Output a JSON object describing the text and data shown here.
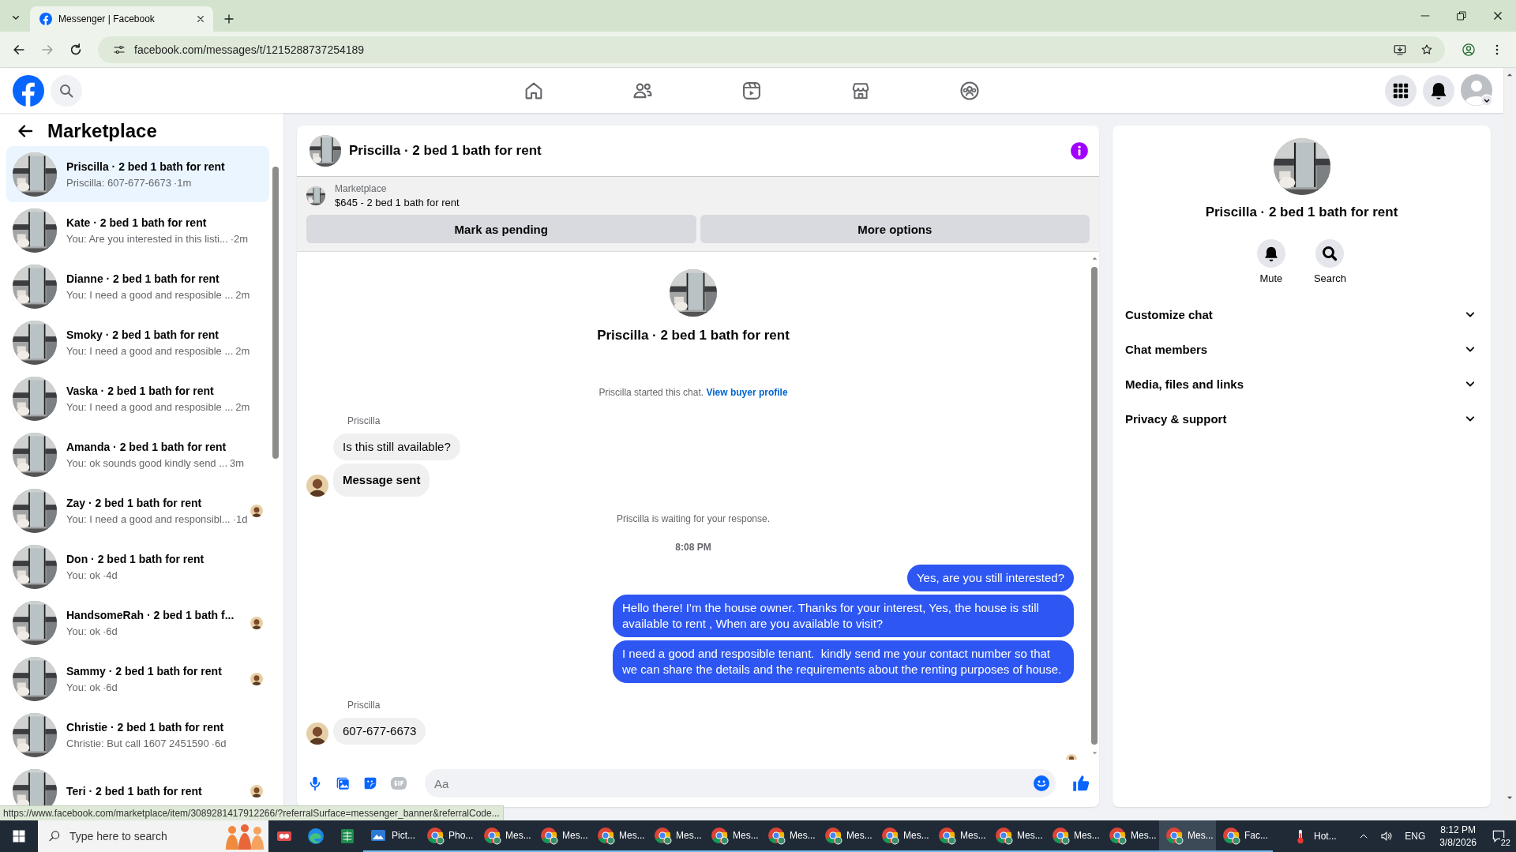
{
  "browser": {
    "tab_title": "Messenger | Facebook",
    "url": "facebook.com/messages/t/1215288737254189",
    "status_url": "https://www.facebook.com/marketplace/item/3089281417912266/?referralSurface=messenger_banner&referralCode..."
  },
  "sidebar": {
    "title": "Marketplace",
    "conversations": [
      {
        "name": "Priscilla · 2 bed 1 bath for rent",
        "preview": "Priscilla: 607-677-6673",
        "time": "·1m",
        "selected": true,
        "seen": false
      },
      {
        "name": "Kate · 2 bed 1 bath for rent",
        "preview": "You: Are you interested in this listi...",
        "time": "·2m",
        "selected": false,
        "seen": false
      },
      {
        "name": "Dianne · 2 bed 1 bath for rent",
        "preview": "You: I need a good and resposible ...",
        "time": "2m",
        "selected": false,
        "seen": false
      },
      {
        "name": "Smoky · 2 bed 1 bath for rent",
        "preview": "You: I need a good and resposible ...",
        "time": "2m",
        "selected": false,
        "seen": false
      },
      {
        "name": "Vaska · 2 bed 1 bath for rent",
        "preview": "You: I need a good and resposible ...",
        "time": "2m",
        "selected": false,
        "seen": false
      },
      {
        "name": "Amanda · 2 bed 1 bath for rent",
        "preview": "You: ok sounds good kindly send ...",
        "time": "3m",
        "selected": false,
        "seen": false
      },
      {
        "name": "Zay · 2 bed 1 bath for rent",
        "preview": "You: I need a good and responsibl...",
        "time": "·1d",
        "selected": false,
        "seen": true
      },
      {
        "name": "Don · 2 bed 1 bath for rent",
        "preview": "You: ok",
        "time": "·4d",
        "selected": false,
        "seen": false
      },
      {
        "name": "HandsomeRah · 2 bed 1 bath f...",
        "preview": "You: ok",
        "time": "·6d",
        "selected": false,
        "seen": true
      },
      {
        "name": "Sammy · 2 bed 1 bath for rent",
        "preview": "You: ok",
        "time": "·6d",
        "selected": false,
        "seen": true
      },
      {
        "name": "Christie · 2 bed 1 bath for rent",
        "preview": "Christie: But call 1607 2451590",
        "time": "·6d",
        "selected": false,
        "seen": false
      },
      {
        "name": "Teri · 2 bed 1 bath for rent",
        "selected": false,
        "seen": true
      }
    ]
  },
  "chat": {
    "title": "Priscilla · 2 bed 1 bath for rent",
    "listing": {
      "label": "Marketplace",
      "price_line": "$645 - 2 bed 1 bath for rent",
      "buttons": [
        "Mark as pending",
        "More options"
      ]
    },
    "intro_name": "Priscilla · 2 bed 1 bath for rent",
    "messages": [
      {
        "kind": "system",
        "text": "Priscilla started this chat.",
        "link": "View buyer profile"
      },
      {
        "kind": "sender",
        "text": "Priscilla"
      },
      {
        "kind": "incoming",
        "text": "Is this still available?",
        "avatar": false,
        "bold": false
      },
      {
        "kind": "incoming",
        "text": "Message sent",
        "avatar": true,
        "bold": true
      },
      {
        "kind": "system",
        "text": "Priscilla is waiting for your response."
      },
      {
        "kind": "time",
        "text": "8:08 PM"
      },
      {
        "kind": "outgoing",
        "text": "Yes, are you still interested?"
      },
      {
        "kind": "outgoing",
        "text": "Hello there! I'm the house owner. Thanks for your interest, Yes, the house is still available to rent , When are you available to visit?"
      },
      {
        "kind": "outgoing",
        "text": "I need a good and resposible tenant.  kindly send me your contact number so that we can share the details and the requirements about the renting purposes of house."
      },
      {
        "kind": "sender",
        "text": "Priscilla"
      },
      {
        "kind": "incoming",
        "text": "607-677-6673",
        "avatar": true,
        "bold": false
      },
      {
        "kind": "seen"
      }
    ],
    "composer": {
      "placeholder": "Aa"
    }
  },
  "info": {
    "name": "Priscilla · 2 bed 1 bath for rent",
    "actions": [
      {
        "kind": "mute",
        "label": "Mute"
      },
      {
        "kind": "search",
        "label": "Search"
      }
    ],
    "sections": [
      {
        "label": "Customize chat",
        "expanded": false
      },
      {
        "label": "Chat members",
        "expanded": false
      },
      {
        "label": "Media, files and links",
        "expanded": false
      },
      {
        "label": "Privacy & support",
        "expanded": false
      }
    ]
  },
  "taskbar": {
    "search_placeholder": "Type here to search",
    "apps": [
      {
        "kind": "snip",
        "selected": false
      },
      {
        "kind": "edge",
        "selected": false
      },
      {
        "kind": "sheet",
        "selected": false
      },
      {
        "kind": "viewer",
        "label": "Pict...",
        "selected": false
      },
      {
        "kind": "browser",
        "label": "Pho...",
        "selected": false
      },
      {
        "kind": "browser",
        "label": "Mes...",
        "selected": false
      },
      {
        "kind": "browser",
        "label": "Mes...",
        "selected": false
      },
      {
        "kind": "browser",
        "label": "Mes...",
        "selected": false
      },
      {
        "kind": "browser",
        "label": "Mes...",
        "selected": false
      },
      {
        "kind": "browser",
        "label": "Mes...",
        "selected": false
      },
      {
        "kind": "browser",
        "label": "Mes...",
        "selected": false
      },
      {
        "kind": "browser",
        "label": "Mes...",
        "selected": false
      },
      {
        "kind": "browser",
        "label": "Mes...",
        "selected": false
      },
      {
        "kind": "browser",
        "label": "Mes...",
        "selected": false
      },
      {
        "kind": "browser",
        "label": "Mes...",
        "selected": false
      },
      {
        "kind": "browser",
        "label": "Mes...",
        "selected": false
      },
      {
        "kind": "browser",
        "label": "Mes...",
        "selected": false
      },
      {
        "kind": "browser",
        "label": "Mes...",
        "selected": true
      },
      {
        "kind": "browser",
        "label": "Fac...",
        "selected": false
      }
    ],
    "weather": "Hot...",
    "language": "ENG",
    "time": "8:12 PM",
    "date": "3/8/2026",
    "notifications": "22"
  }
}
